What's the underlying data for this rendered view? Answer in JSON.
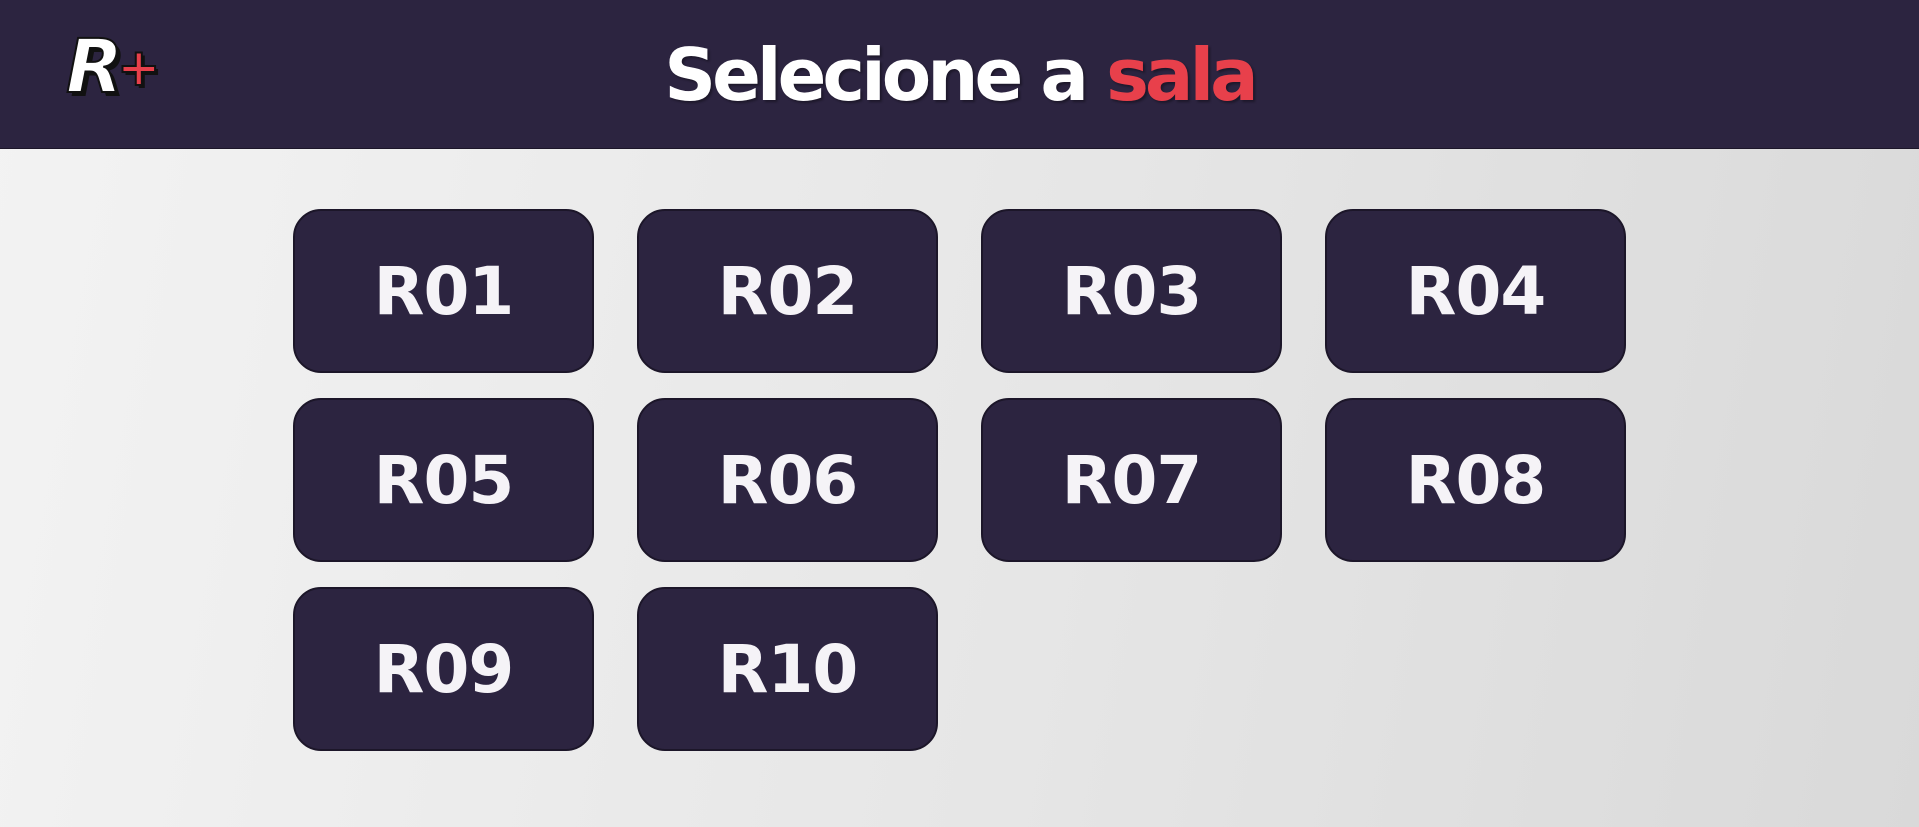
{
  "header": {
    "logo": {
      "letter": "R",
      "plus": "+"
    },
    "title": {
      "prefix": "Selecione a ",
      "highlight": "sala"
    }
  },
  "rooms": [
    "R01",
    "R02",
    "R03",
    "R04",
    "R05",
    "R06",
    "R07",
    "R08",
    "R09",
    "R10"
  ],
  "colors": {
    "header_bg": "#2c2440",
    "accent": "#e8404b",
    "button_bg": "#2c2440",
    "button_text": "#f5f3f7",
    "page_bg": "#e6e6e6"
  }
}
